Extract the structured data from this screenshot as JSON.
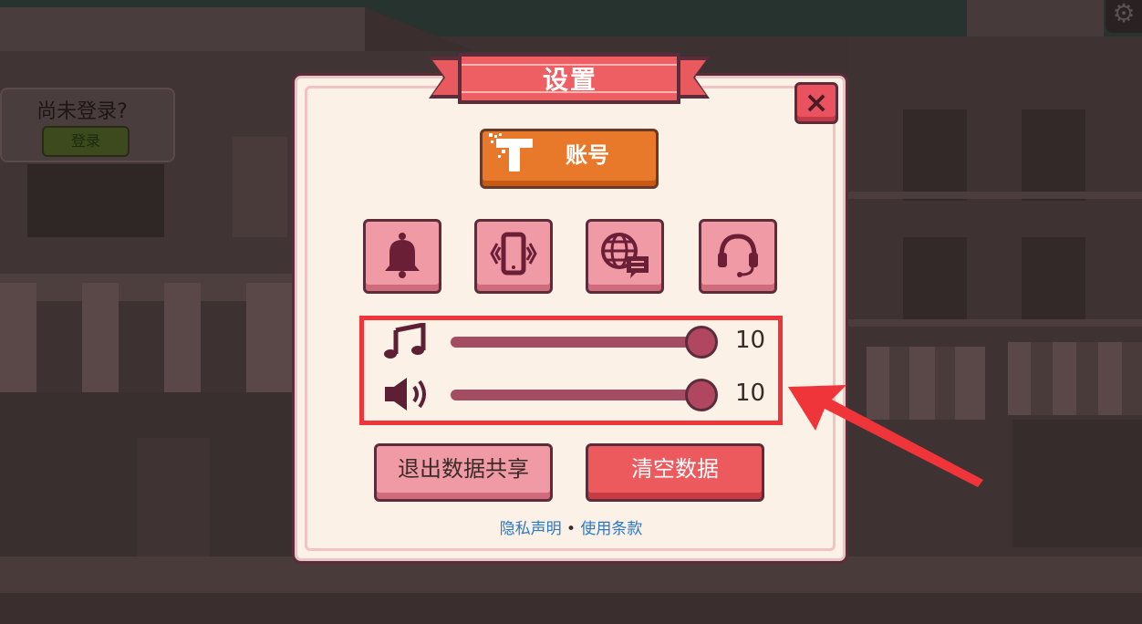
{
  "login": {
    "prompt": "尚未登录?",
    "button": "登录"
  },
  "dialog": {
    "title": "设置",
    "close_label": "×",
    "account_button": "账号",
    "icon_buttons": [
      "bell-icon",
      "vibration-icon",
      "language-icon",
      "support-headset-icon"
    ],
    "sliders": {
      "music": {
        "icon": "music-note-icon",
        "value": "10",
        "max": 10
      },
      "sound": {
        "icon": "speaker-icon",
        "value": "10",
        "max": 10
      }
    },
    "exit_share_button": "退出数据共享",
    "clear_data_button": "清空数据",
    "links": {
      "privacy": "隐私声明",
      "separator": "•",
      "terms": "使用条款"
    }
  },
  "colors": {
    "highlight": "#f0353a",
    "primary_button": "#ec5a5e",
    "account_button": "#e8782a",
    "pink_button": "#ef9aa4",
    "link": "#2c78c8",
    "slider_track": "#a44d62"
  }
}
